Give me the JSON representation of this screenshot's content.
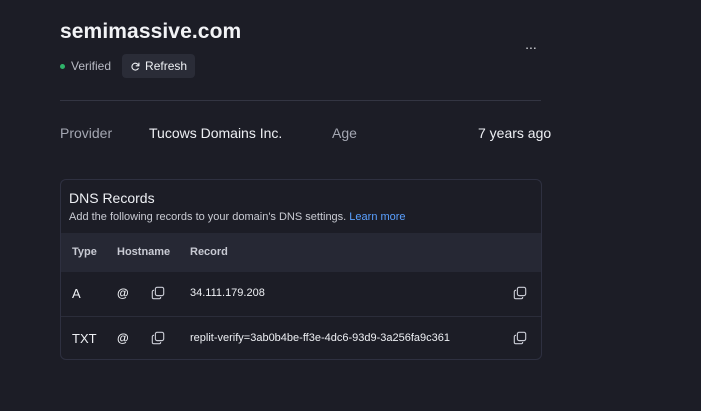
{
  "header": {
    "title": "semimassive.com",
    "more_label": "...",
    "status": "Verified",
    "refresh_label": "Refresh"
  },
  "meta": {
    "provider_label": "Provider",
    "provider_value": "Tucows Domains Inc.",
    "age_label": "Age",
    "age_value": "7 years ago"
  },
  "dns": {
    "title": "DNS Records",
    "subtitle": "Add the following records to your domain's DNS settings.",
    "learn_more": "Learn more",
    "columns": [
      "Type",
      "Hostname",
      "Record"
    ],
    "rows": [
      {
        "type": "A",
        "hostname": "@",
        "record": "34.111.179.208"
      },
      {
        "type": "TXT",
        "hostname": "@",
        "record": "replit-verify=3ab0b4be-ff3e-4dc6-93d9-3a256fa9c361"
      }
    ]
  },
  "colors": {
    "background": "#1c1d26",
    "verified_dot": "#2fb36a",
    "link": "#5aa0ff"
  }
}
